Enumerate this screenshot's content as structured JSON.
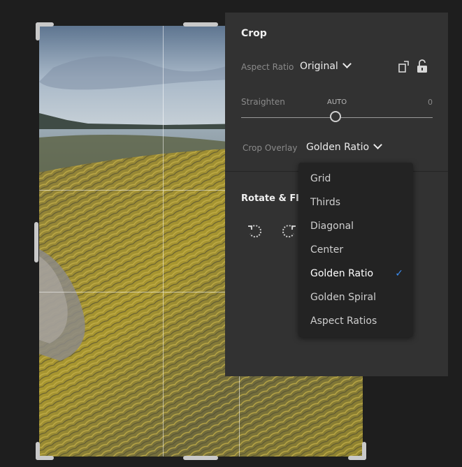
{
  "panel": {
    "title": "Crop",
    "aspect_ratio": {
      "label": "Aspect Ratio",
      "value": "Original"
    },
    "straighten": {
      "label": "Straighten",
      "auto_label": "AUTO",
      "value": "0"
    },
    "crop_overlay": {
      "label": "Crop Overlay",
      "value": "Golden Ratio"
    },
    "rotate_flip": {
      "title": "Rotate & Fli"
    }
  },
  "dropdown": {
    "items": [
      "Grid",
      "Thirds",
      "Diagonal",
      "Center",
      "Golden Ratio",
      "Golden Spiral",
      "Aspect Ratios"
    ],
    "selected": "Golden Ratio"
  },
  "colors": {
    "panel_bg": "#323232",
    "dropdown_bg": "#232323",
    "accent": "#3b8cf0"
  }
}
